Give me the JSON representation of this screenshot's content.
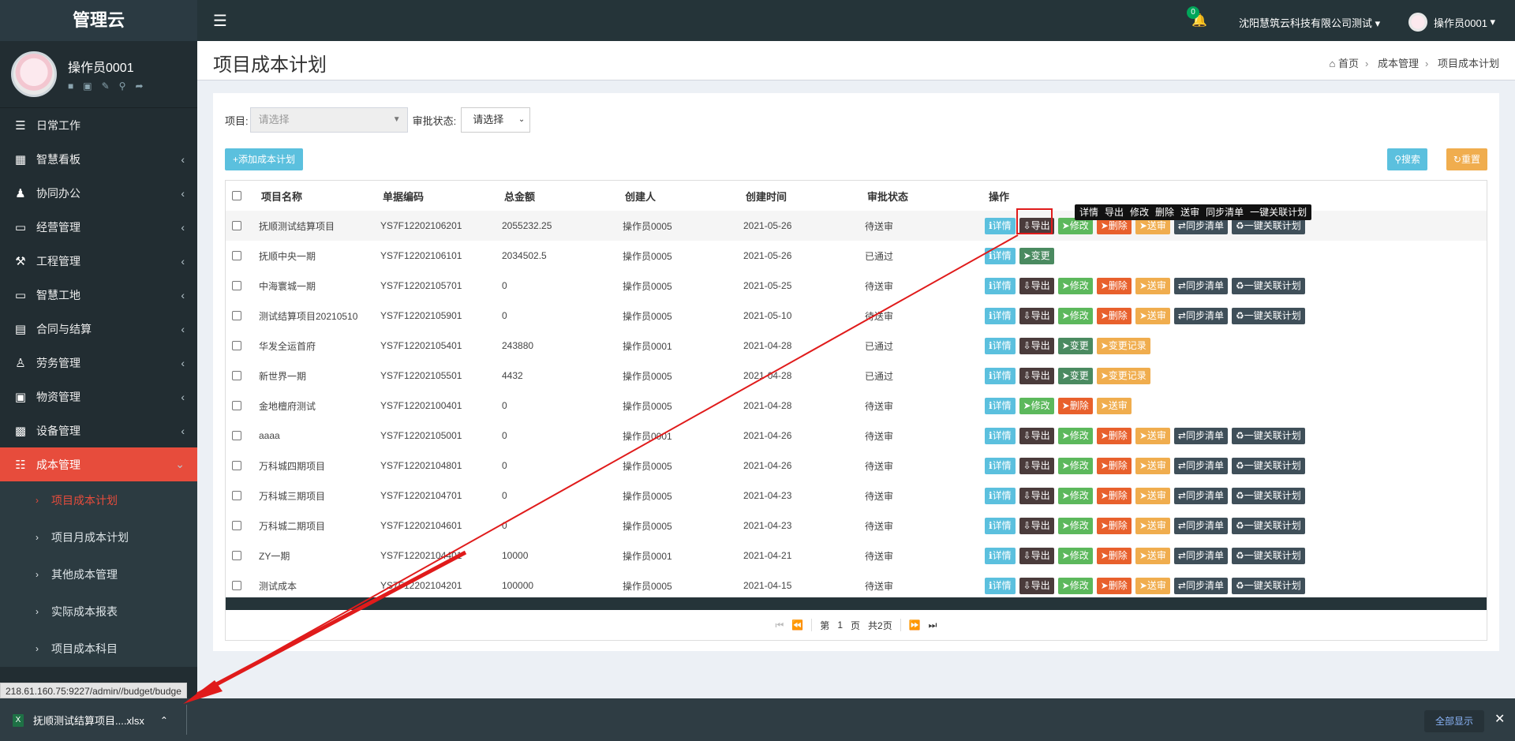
{
  "app": {
    "brand": "管理云",
    "colors": {
      "accent": "#e74c3c",
      "sidebar": "#222d32",
      "header": "#253439",
      "info": "#5bc0de",
      "warning": "#f0ad4e",
      "success": "#5cb85c"
    }
  },
  "sidebar": {
    "user_name": "操作员0001",
    "user_icons": [
      "user-icon",
      "card-icon",
      "edit-icon",
      "key-icon",
      "logout-icon"
    ],
    "menu": [
      {
        "label": "日常工作",
        "icon": "list-icon"
      },
      {
        "label": "智慧看板",
        "icon": "dashboard-icon"
      },
      {
        "label": "协同办公",
        "icon": "users-icon"
      },
      {
        "label": "经营管理",
        "icon": "monitor-icon"
      },
      {
        "label": "工程管理",
        "icon": "gavel-icon"
      },
      {
        "label": "智慧工地",
        "icon": "monitor-icon"
      },
      {
        "label": "合同与结算",
        "icon": "file-icon"
      },
      {
        "label": "劳务管理",
        "icon": "worker-icon"
      },
      {
        "label": "物资管理",
        "icon": "box-icon"
      },
      {
        "label": "设备管理",
        "icon": "cubes-icon"
      },
      {
        "label": "成本管理",
        "icon": "table-icon"
      }
    ],
    "submenu": [
      {
        "label": "项目成本计划",
        "active": true
      },
      {
        "label": "项目月成本计划"
      },
      {
        "label": "其他成本管理"
      },
      {
        "label": "实际成本报表"
      },
      {
        "label": "项目成本科目"
      }
    ]
  },
  "header": {
    "notifications": "0",
    "company": "沈阳慧筑云科技有限公司测试",
    "user": "操作员0001"
  },
  "page": {
    "title": "项目成本计划",
    "breadcrumb": [
      "首页",
      "成本管理",
      "项目成本计划"
    ]
  },
  "filters": {
    "project_label": "项目:",
    "project_placeholder": "请选择",
    "status_label": "审批状态:",
    "status_value": "请选择"
  },
  "buttons": {
    "add": "添加成本计划",
    "search": "搜索",
    "reset": "重置"
  },
  "table": {
    "headers": [
      "项目名称",
      "单据编码",
      "总金额",
      "创建人",
      "创建时间",
      "审批状态",
      "操作"
    ],
    "rows": [
      {
        "name": "抚顺测试结算项目",
        "code": "YS7F12202106201",
        "amount": "2055232.25",
        "creator": "操作员0005",
        "time": "2021-05-26",
        "status": "待送审",
        "ops": [
          "详情",
          "导出",
          "修改",
          "删除",
          "送审",
          "同步清单",
          "一键关联计划"
        ]
      },
      {
        "name": "抚顺中央一期",
        "code": "YS7F12202106101",
        "amount": "2034502.5",
        "creator": "操作员0005",
        "time": "2021-05-26",
        "status": "已通过",
        "ops": [
          "详情",
          "变更"
        ]
      },
      {
        "name": "中海寰城一期",
        "code": "YS7F12202105701",
        "amount": "0",
        "creator": "操作员0005",
        "time": "2021-05-25",
        "status": "待送审",
        "ops": [
          "详情",
          "导出",
          "修改",
          "删除",
          "送审",
          "同步清单",
          "一键关联计划"
        ]
      },
      {
        "name": "测试结算项目20210510",
        "code": "YS7F12202105901",
        "amount": "0",
        "creator": "操作员0005",
        "time": "2021-05-10",
        "status": "待送审",
        "ops": [
          "详情",
          "导出",
          "修改",
          "删除",
          "送审",
          "同步清单",
          "一键关联计划"
        ]
      },
      {
        "name": "华发全运首府",
        "code": "YS7F12202105401",
        "amount": "243880",
        "creator": "操作员0001",
        "time": "2021-04-28",
        "status": "已通过",
        "ops": [
          "详情",
          "导出",
          "变更",
          "变更记录"
        ]
      },
      {
        "name": "新世界一期",
        "code": "YS7F12202105501",
        "amount": "4432",
        "creator": "操作员0005",
        "time": "2021-04-28",
        "status": "已通过",
        "ops": [
          "详情",
          "导出",
          "变更",
          "变更记录"
        ]
      },
      {
        "name": "金地檀府测试",
        "code": "YS7F12202100401",
        "amount": "0",
        "creator": "操作员0005",
        "time": "2021-04-28",
        "status": "待送审",
        "ops": [
          "详情",
          "修改",
          "删除",
          "送审"
        ]
      },
      {
        "name": "aaaa",
        "code": "YS7F12202105001",
        "amount": "0",
        "creator": "操作员0001",
        "time": "2021-04-26",
        "status": "待送审",
        "ops": [
          "详情",
          "导出",
          "修改",
          "删除",
          "送审",
          "同步清单",
          "一键关联计划"
        ]
      },
      {
        "name": "万科城四期项目",
        "code": "YS7F12202104801",
        "amount": "0",
        "creator": "操作员0005",
        "time": "2021-04-26",
        "status": "待送审",
        "ops": [
          "详情",
          "导出",
          "修改",
          "删除",
          "送审",
          "同步清单",
          "一键关联计划"
        ]
      },
      {
        "name": "万科城三期项目",
        "code": "YS7F12202104701",
        "amount": "0",
        "creator": "操作员0005",
        "time": "2021-04-23",
        "status": "待送审",
        "ops": [
          "详情",
          "导出",
          "修改",
          "删除",
          "送审",
          "同步清单",
          "一键关联计划"
        ]
      },
      {
        "name": "万科城二期项目",
        "code": "YS7F12202104601",
        "amount": "0",
        "creator": "操作员0005",
        "time": "2021-04-23",
        "status": "待送审",
        "ops": [
          "详情",
          "导出",
          "修改",
          "删除",
          "送审",
          "同步清单",
          "一键关联计划"
        ]
      },
      {
        "name": "ZY一期",
        "code": "YS7F12202104401",
        "amount": "10000",
        "creator": "操作员0001",
        "time": "2021-04-21",
        "status": "待送审",
        "ops": [
          "详情",
          "导出",
          "修改",
          "删除",
          "送审",
          "同步清单",
          "一键关联计划"
        ]
      },
      {
        "name": "测试成本",
        "code": "YS7F12202104201",
        "amount": "100000",
        "creator": "操作员0005",
        "time": "2021-04-15",
        "status": "待送审",
        "ops": [
          "详情",
          "导出",
          "修改",
          "删除",
          "送审",
          "同步清单",
          "一键关联计划"
        ]
      }
    ]
  },
  "tooltip": [
    "详情",
    "导出",
    "修改",
    "删除",
    "送审",
    "同步清单",
    "一键关联计划"
  ],
  "pager": {
    "page_prefix": "第",
    "page_num": "1",
    "page_suffix": "页",
    "total": "共2页"
  },
  "status_url": "218.61.160.75:9227/admin//budget/budge",
  "download": {
    "filename": "抚顺测试结算项目....xlsx",
    "show_all": "全部显示"
  }
}
